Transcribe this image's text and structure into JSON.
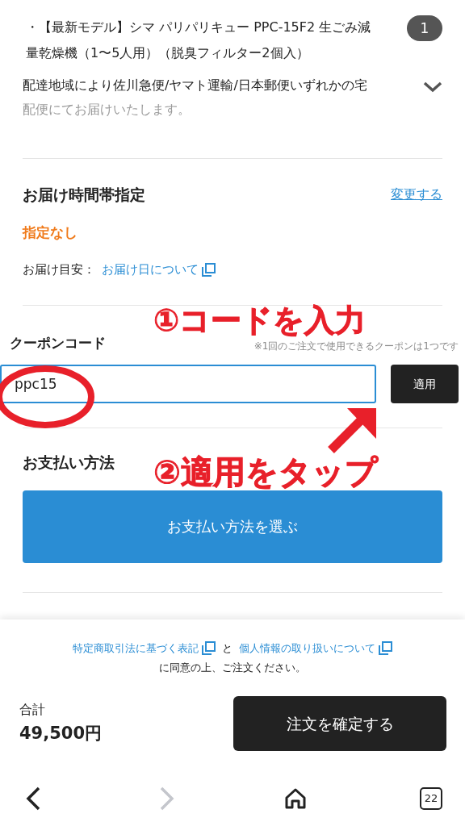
{
  "order_item": {
    "name": "・【最新モデル】シマ パリパリキュー PPC-15F2 生ごみ減量乾燥機（1〜5人用）（脱臭フィルター2個入）",
    "quantity": "1"
  },
  "shipping_note": {
    "text": "配達地域により佐川急便/ヤマト運輸/日本郵便いずれかの宅",
    "faded_text": "配便にてお届けいたします。",
    "expanded": false
  },
  "delivery_time": {
    "title": "お届け時間帯指定",
    "change_link": "変更する",
    "value": "指定なし",
    "estimate_label": "お届け目安：",
    "estimate_link": "お届け日について"
  },
  "coupon": {
    "label": "クーポンコード",
    "note": "※1回のご注文で使用できるクーポンは1つです",
    "value": "ppc15",
    "apply_button": "適用"
  },
  "payment": {
    "title": "お支払い方法",
    "button": "お支払い方法を選ぶ"
  },
  "agreement": {
    "link_1": "特定商取引法に基づく表記",
    "joiner": "と",
    "link_2": "個人情報の取り扱いについて",
    "suffix": "に同意の上、ご注文ください。"
  },
  "total": {
    "label": "合計",
    "amount": "49,500円",
    "confirm_button": "注文を確定する"
  },
  "browser_bar": {
    "tab_count": "22",
    "back_enabled": true,
    "forward_enabled": false
  },
  "annotations": [
    {
      "kind": "text",
      "text": "①コードを入力"
    },
    {
      "kind": "text",
      "text": "②適用をタップ"
    },
    {
      "kind": "circle"
    },
    {
      "kind": "arrow"
    }
  ]
}
